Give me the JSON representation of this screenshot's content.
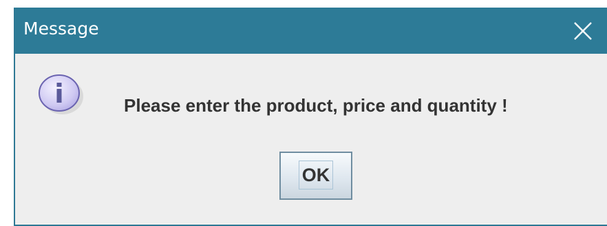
{
  "window": {
    "title": "Message",
    "close_icon": "close-icon",
    "title_bar_color": "#2d7b97"
  },
  "body": {
    "icon": "information-icon",
    "message": "Please enter the product, price and quantity !"
  },
  "buttons": {
    "ok_label": "OK"
  }
}
